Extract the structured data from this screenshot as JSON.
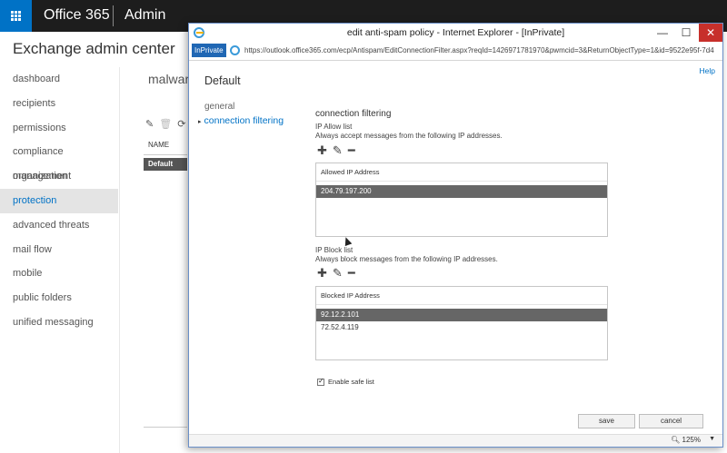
{
  "topbar": {
    "brand": "Office 365",
    "section": "Admin"
  },
  "eac": {
    "title": "Exchange admin center",
    "nav": [
      "dashboard",
      "recipients",
      "permissions",
      "compliance management",
      "organization",
      "protection",
      "advanced threats",
      "mail flow",
      "mobile",
      "public folders",
      "unified messaging"
    ],
    "active_nav": "protection",
    "page_heading": "malware",
    "table_header": "NAME",
    "table_row": "Default"
  },
  "window": {
    "title": "edit anti-spam policy - Internet Explorer - [InPrivate]",
    "inprivate_label": "InPrivate",
    "url": "https://outlook.office365.com/ecp/Antispam/EditConnectionFilter.aspx?reqId=1426971781970&pwmcid=3&ReturnObjectType=1&id=9522e95f-7d4",
    "help": "Help",
    "zoom": "125%"
  },
  "policy": {
    "name": "Default",
    "sections": [
      "general",
      "connection filtering"
    ],
    "active_section": "connection filtering",
    "heading": "connection filtering",
    "allow": {
      "label": "IP Allow list",
      "description": "Always accept messages from the following IP addresses.",
      "column": "Allowed IP Address",
      "items": [
        "204.79.197.200"
      ],
      "selected_index": 0
    },
    "block": {
      "label": "IP Block list",
      "description": "Always block messages from the following IP addresses.",
      "column": "Blocked IP Address",
      "items": [
        "92.12.2.101",
        "72.52.4.119"
      ],
      "selected_index": 0
    },
    "safe_list": {
      "label": "Enable safe list",
      "checked": true
    },
    "buttons": {
      "save": "save",
      "cancel": "cancel"
    }
  }
}
